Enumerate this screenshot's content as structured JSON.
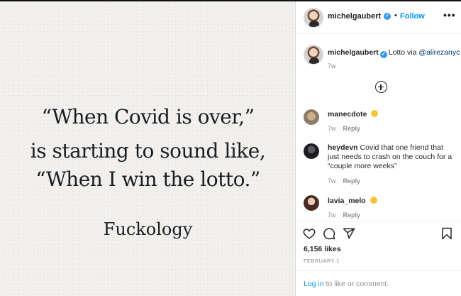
{
  "image": {
    "quote_lines": [
      "“When Covid is over,”",
      "is starting to sound like,",
      "“When I win the lotto.”"
    ],
    "signature": "Fuckology"
  },
  "header": {
    "username": "michelgaubert",
    "separator": "•",
    "follow_label": "Follow",
    "more_label": "•••"
  },
  "caption": {
    "username": "michelgaubert",
    "text": "Lotto via ",
    "mention": "@alirezanyc",
    "time": "7w"
  },
  "comments": [
    {
      "username": "manecdote",
      "text": "",
      "time": "7w",
      "reply_label": "Reply",
      "emoji": "silly-face-emoji"
    },
    {
      "username": "heydevn",
      "text": "Covid that one friend that just needs to crash on the couch for a “couple more weeks”",
      "time": "7w",
      "reply_label": "Reply"
    },
    {
      "username": "lavia_melo",
      "text": "",
      "time": "7w",
      "reply_label": "Reply",
      "emoji": "laughing-face-emoji"
    }
  ],
  "actions": {
    "likes": "6,156 likes",
    "date": "FEBRUARY 1",
    "login_link": "Log in",
    "login_suffix": " to like or comment."
  },
  "colors": {
    "link_blue": "#0095f6",
    "mention_blue": "#00376b",
    "muted_gray": "#8e8e8e",
    "verified_blue": "#3897f0"
  }
}
